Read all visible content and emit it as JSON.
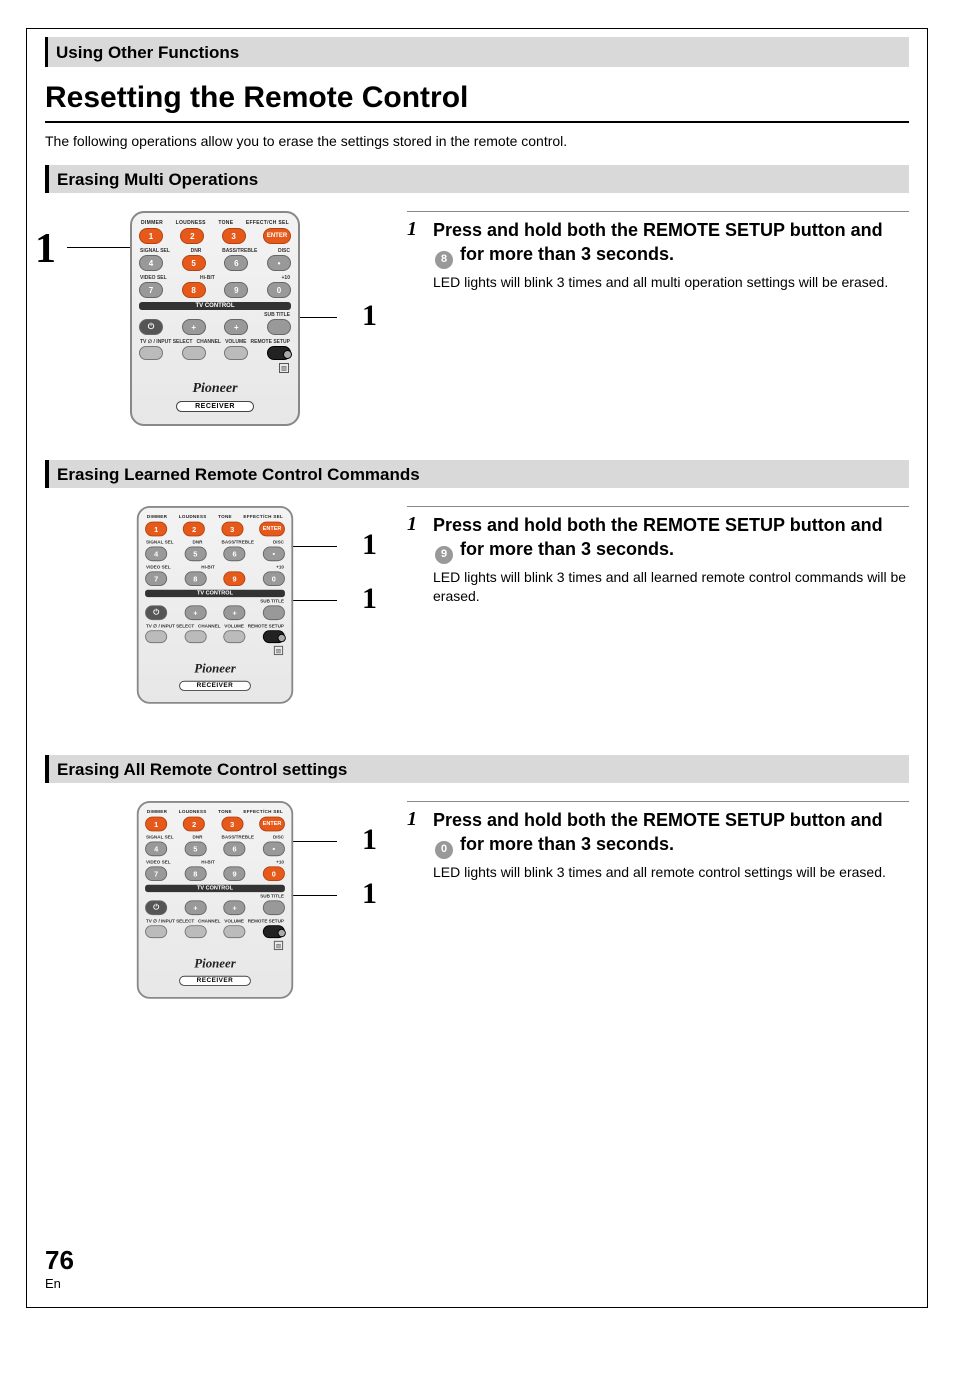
{
  "chapter": "Using Other Functions",
  "title": "Resetting the Remote Control",
  "intro": "The following operations allow you to erase the settings stored in the remote control.",
  "sections": [
    {
      "heading": "Erasing Multi Operations",
      "step_number": "1",
      "key_digit": "8",
      "instruction_pre": "Press and hold both the REMOTE SETUP button and ",
      "instruction_post": " for more than 3 seconds.",
      "detail": "LED lights will blink 3 times and all multi operation settings will be erased."
    },
    {
      "heading": "Erasing Learned Remote Control Commands",
      "step_number": "1",
      "key_digit": "9",
      "instruction_pre": "Press and hold both the REMOTE SETUP button and ",
      "instruction_post": " for more than 3 seconds.",
      "detail": "LED lights will blink 3 times and all learned remote control commands will be erased."
    },
    {
      "heading": "Erasing All Remote Control settings",
      "step_number": "1",
      "key_digit": "0",
      "instruction_pre": "Press and hold both the REMOTE SETUP button and ",
      "instruction_post": " for more than 3 seconds.",
      "detail": "LED lights will blink 3 times and all remote control settings will be erased."
    }
  ],
  "remote": {
    "top_labels": [
      "DIMMER",
      "LOUDNESS",
      "TONE",
      "EFFECT/CH SEL"
    ],
    "enter": "ENTER",
    "mid_labels_left": "SIGNAL SEL",
    "mid_labels_2": "DNR",
    "mid_labels_3": "BASS/TREBLE",
    "mid_labels_right": "DISC",
    "row3_left": "VIDEO SEL",
    "row3_2": "Hi-BIT",
    "row3_right": "+10",
    "tv_control": "TV  CONTROL",
    "subtitle": "SUB TITLE",
    "bottom_labels": [
      "TV ∅ / INPUT SELECT",
      "CHANNEL",
      "VOLUME",
      "REMOTE SETUP"
    ],
    "brand": "Pioneer",
    "receiver": "RECEIVER",
    "d": [
      "1",
      "2",
      "3",
      "4",
      "5",
      "6",
      "7",
      "8",
      "9",
      "0"
    ]
  },
  "callout_digit": "1",
  "page_number": "76",
  "page_lang": "En"
}
